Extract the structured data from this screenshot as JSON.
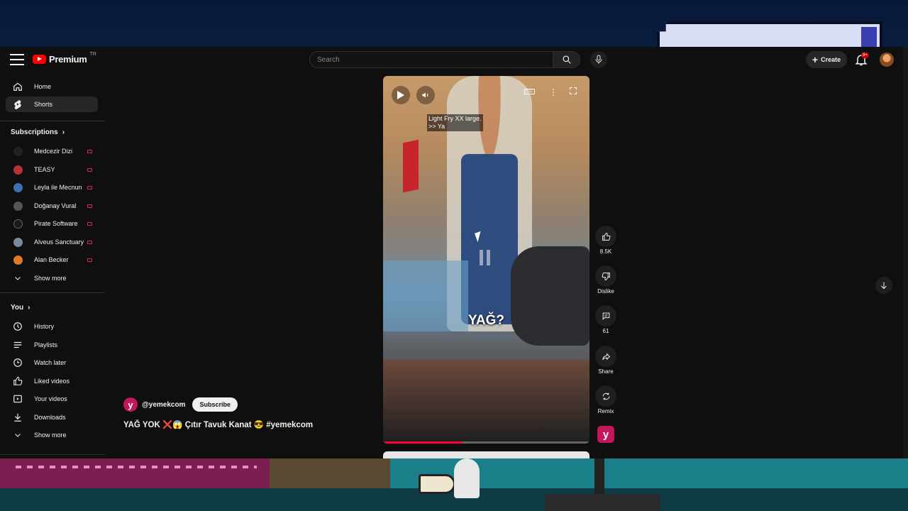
{
  "colors": {
    "accent_red": "#ff0000",
    "live_red": "#cc3344",
    "channel_brand": "#c2185b",
    "bg": "#0f0f0f"
  },
  "masthead": {
    "logo_text": "Premium",
    "logo_region": "TR",
    "search_placeholder": "Search",
    "create_label": "Create",
    "notif_badge": "9+"
  },
  "sidebar": {
    "main": [
      {
        "label": "Home",
        "icon": "home-icon"
      },
      {
        "label": "Shorts",
        "icon": "shorts-icon",
        "active": true
      }
    ],
    "subscriptions_title": "Subscriptions",
    "subscriptions": [
      {
        "label": "Medcezir Dizi",
        "color": "#222222"
      },
      {
        "label": "TEASY",
        "color": "#b8323d"
      },
      {
        "label": "Leyla ile Mecnun",
        "color": "#3c6fb4"
      },
      {
        "label": "Doğanay Vural",
        "color": "#555555"
      },
      {
        "label": "Pirate Software",
        "color": "#1a1a1a"
      },
      {
        "label": "Alveus Sanctuary",
        "color": "#7a8a99"
      },
      {
        "label": "Alan Becker",
        "color": "#e07a2a"
      }
    ],
    "subs_show_more": "Show more",
    "you_title": "You",
    "you_items": [
      {
        "label": "History",
        "icon": "history-icon"
      },
      {
        "label": "Playlists",
        "icon": "playlists-icon"
      },
      {
        "label": "Watch later",
        "icon": "watch-later-icon"
      },
      {
        "label": "Liked videos",
        "icon": "liked-videos-icon"
      },
      {
        "label": "Your videos",
        "icon": "your-videos-icon"
      },
      {
        "label": "Downloads",
        "icon": "downloads-icon"
      }
    ],
    "you_show_more": "Show more"
  },
  "short": {
    "overlay_text_line1": "Light Fry XX large.",
    "overlay_text_line2": ">> Ya",
    "cc_label": "CC",
    "caption": "YAĞ?",
    "progress": 0.38,
    "channel_handle": "@yemekcom",
    "channel_avatar_letter": "y",
    "subscribe_label": "Subscribe",
    "title": "YAĞ YOK ❌😱 Çıtır Tavuk Kanat 😎 #yemekcom"
  },
  "actions": {
    "like_count": "8.5K",
    "dislike_label": "Dislike",
    "comment_count": "61",
    "share_label": "Share",
    "remix_label": "Remix"
  }
}
